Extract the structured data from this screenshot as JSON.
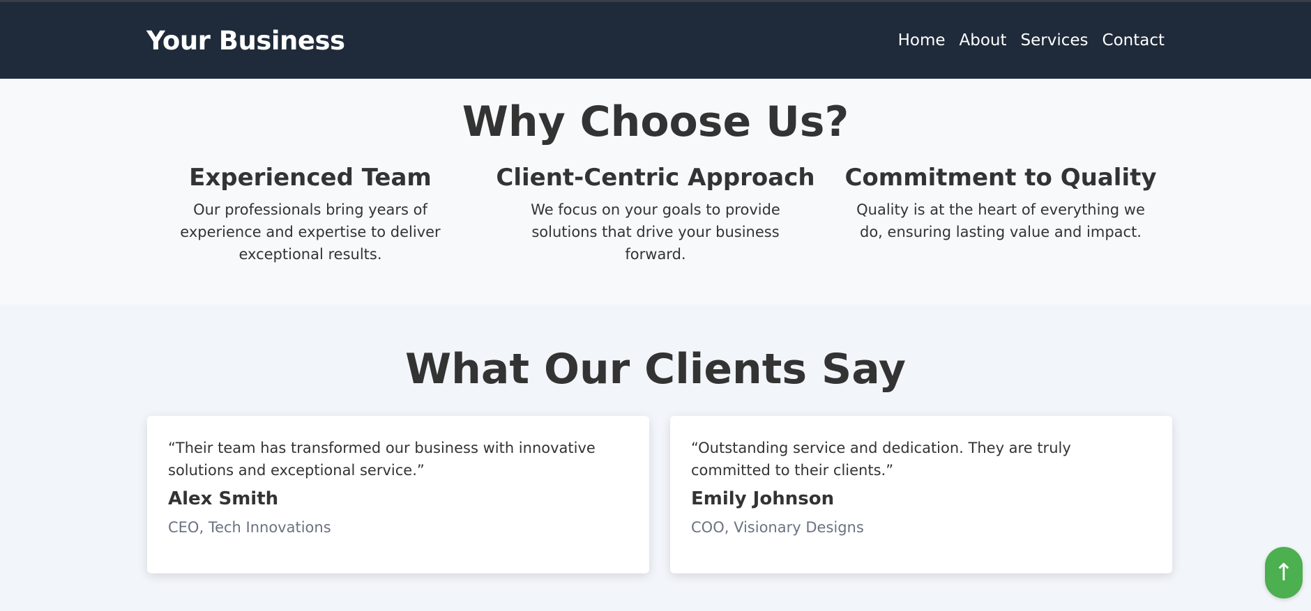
{
  "header": {
    "brand": "Your Business",
    "nav": [
      "Home",
      "About",
      "Services",
      "Contact"
    ]
  },
  "why": {
    "title": "Why Choose Us?",
    "features": [
      {
        "title": "Experienced Team",
        "text": "Our professionals bring years of experience and expertise to deliver exceptional results."
      },
      {
        "title": "Client-Centric Approach",
        "text": "We focus on your goals to provide solutions that drive your business forward."
      },
      {
        "title": "Commitment to Quality",
        "text": "Quality is at the heart of everything we do, ensuring lasting value and impact."
      }
    ]
  },
  "testimonials": {
    "title": "What Our Clients Say",
    "items": [
      {
        "quote": "“Their team has transformed our business with innovative solutions and exceptional service.”",
        "name": "Alex Smith",
        "role": "CEO, Tech Innovations"
      },
      {
        "quote": "“Outstanding service and dedication. They are truly committed to their clients.”",
        "name": "Emily Johnson",
        "role": "COO, Visionary Designs"
      }
    ]
  },
  "back_to_top": {
    "icon": "arrow-up-icon",
    "glyph": "↑",
    "color": "#4caf50"
  },
  "colors": {
    "header_bg": "#1f2a3a",
    "text": "#333333",
    "muted": "#6b7280",
    "accent": "#4caf50"
  }
}
